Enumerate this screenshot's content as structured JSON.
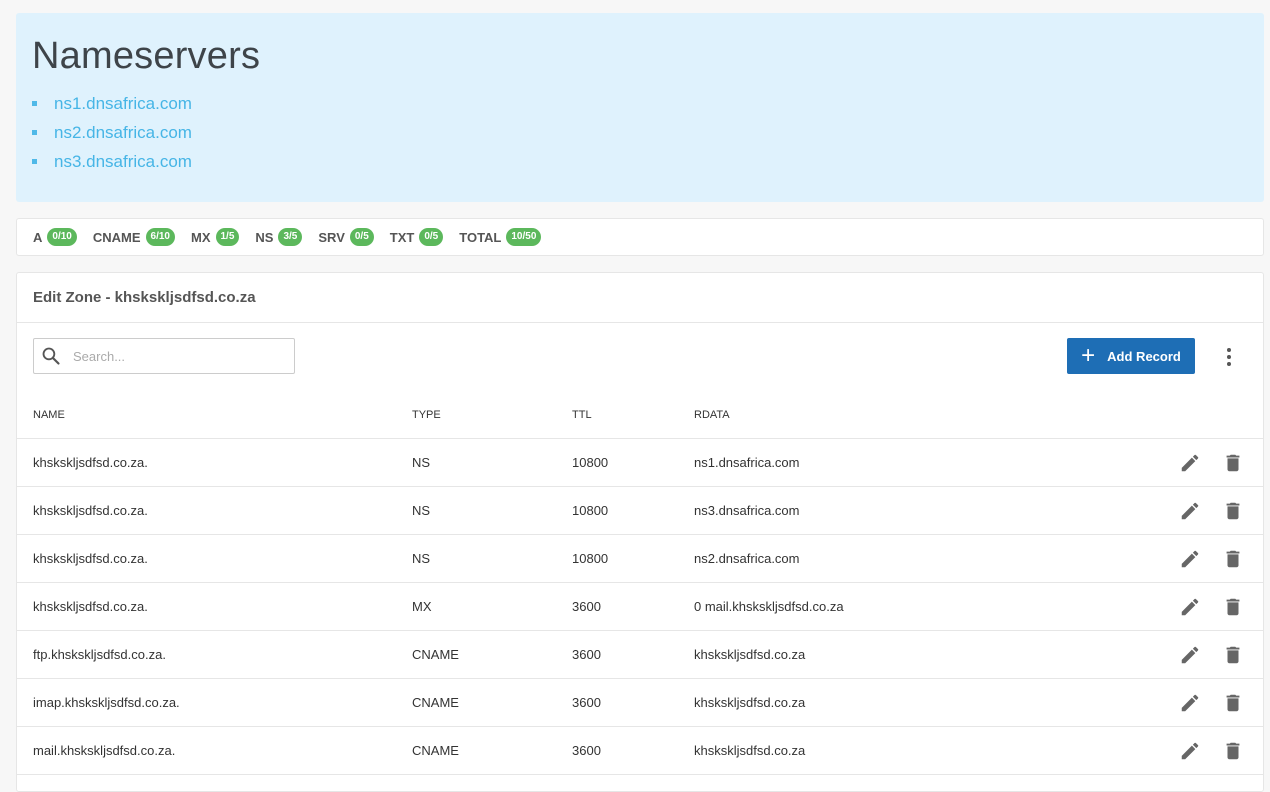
{
  "nameservers": {
    "title": "Nameservers",
    "items": [
      "ns1.dnsafrica.com",
      "ns2.dnsafrica.com",
      "ns3.dnsafrica.com"
    ]
  },
  "counts": [
    {
      "label": "A",
      "badge": "0/10"
    },
    {
      "label": "CNAME",
      "badge": "6/10"
    },
    {
      "label": "MX",
      "badge": "1/5"
    },
    {
      "label": "NS",
      "badge": "3/5"
    },
    {
      "label": "SRV",
      "badge": "0/5"
    },
    {
      "label": "TXT",
      "badge": "0/5"
    },
    {
      "label": "TOTAL",
      "badge": "10/50"
    }
  ],
  "zone": {
    "title": "Edit Zone - khskskljsdfsd.co.za",
    "search_placeholder": "Search...",
    "add_label": "Add Record",
    "columns": {
      "name": "NAME",
      "type": "TYPE",
      "ttl": "TTL",
      "rdata": "RDATA"
    },
    "rows": [
      {
        "name": "khskskljsdfsd.co.za.",
        "type": "NS",
        "ttl": "10800",
        "rdata": "ns1.dnsafrica.com"
      },
      {
        "name": "khskskljsdfsd.co.za.",
        "type": "NS",
        "ttl": "10800",
        "rdata": "ns3.dnsafrica.com"
      },
      {
        "name": "khskskljsdfsd.co.za.",
        "type": "NS",
        "ttl": "10800",
        "rdata": "ns2.dnsafrica.com"
      },
      {
        "name": "khskskljsdfsd.co.za.",
        "type": "MX",
        "ttl": "3600",
        "rdata": "0 mail.khskskljsdfsd.co.za"
      },
      {
        "name": "ftp.khskskljsdfsd.co.za.",
        "type": "CNAME",
        "ttl": "3600",
        "rdata": "khskskljsdfsd.co.za"
      },
      {
        "name": "imap.khskskljsdfsd.co.za.",
        "type": "CNAME",
        "ttl": "3600",
        "rdata": "khskskljsdfsd.co.za"
      },
      {
        "name": "mail.khskskljsdfsd.co.za.",
        "type": "CNAME",
        "ttl": "3600",
        "rdata": "khskskljsdfsd.co.za"
      }
    ]
  },
  "colors": {
    "ns_panel_bg": "#dff2fd",
    "link": "#46b5e6",
    "badge": "#5cb85c",
    "primary_button": "#1e6eb5",
    "icon": "#666666"
  },
  "icons": {
    "search": "search-icon",
    "add": "plus-icon",
    "more": "more-vertical-icon",
    "edit": "pencil-icon",
    "delete": "trash-icon"
  }
}
